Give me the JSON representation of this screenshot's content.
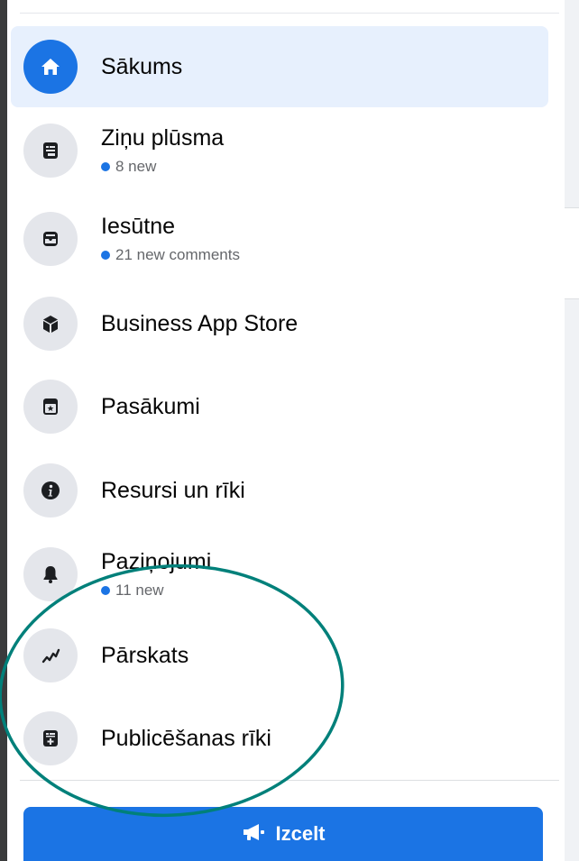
{
  "menu": {
    "items": [
      {
        "label": "Sākums",
        "icon": "home-icon",
        "active": true
      },
      {
        "label": "Ziņu plūsma",
        "icon": "news-feed-icon",
        "sub": "8 new"
      },
      {
        "label": "Iesūtne",
        "icon": "inbox-icon",
        "sub": "21 new comments"
      },
      {
        "label": "Business App Store",
        "icon": "cube-icon"
      },
      {
        "label": "Pasākumi",
        "icon": "calendar-star-icon"
      },
      {
        "label": "Resursi un rīki",
        "icon": "info-icon"
      },
      {
        "label": "Paziņojumi",
        "icon": "bell-icon",
        "sub": "11 new"
      },
      {
        "label": "Pārskats",
        "icon": "trend-line-icon"
      },
      {
        "label": "Publicēšanas rīki",
        "icon": "publishing-tools-icon"
      }
    ]
  },
  "boost": {
    "label": "Izcelt",
    "icon": "megaphone-icon"
  },
  "colors": {
    "accent": "#1b74e4",
    "active_bg": "#e7f0fd",
    "annotation": "#00807a"
  }
}
